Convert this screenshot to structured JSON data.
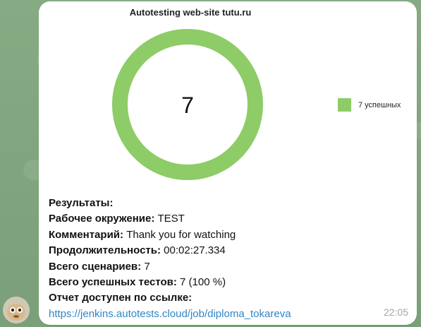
{
  "chart": {
    "title": "Autotesting web-site tutu.ru",
    "center_value": "7",
    "legend": [
      {
        "label": "7 успешных",
        "color": "#8ecc67"
      }
    ],
    "chart_data": {
      "type": "pie",
      "categories": [
        "7 успешных"
      ],
      "values": [
        7
      ],
      "title": "Autotesting web-site tutu.ru"
    }
  },
  "results": {
    "heading": "Результаты:",
    "env_label": "Рабочее окружение:",
    "env_value": "TEST",
    "comment_label": "Комментарий:",
    "comment_value": "Thank you for watching",
    "duration_label": "Продолжительность:",
    "duration_value": "00:02:27.334",
    "scenarios_label": "Всего сценариев:",
    "scenarios_value": "7",
    "success_label": "Всего успешных тестов:",
    "success_value": "7 (100 %)",
    "report_label": "Отчет доступен по ссылке:",
    "report_link": "https://jenkins.autotests.cloud/job/diploma_tokareva"
  },
  "message": {
    "time": "22:05"
  }
}
